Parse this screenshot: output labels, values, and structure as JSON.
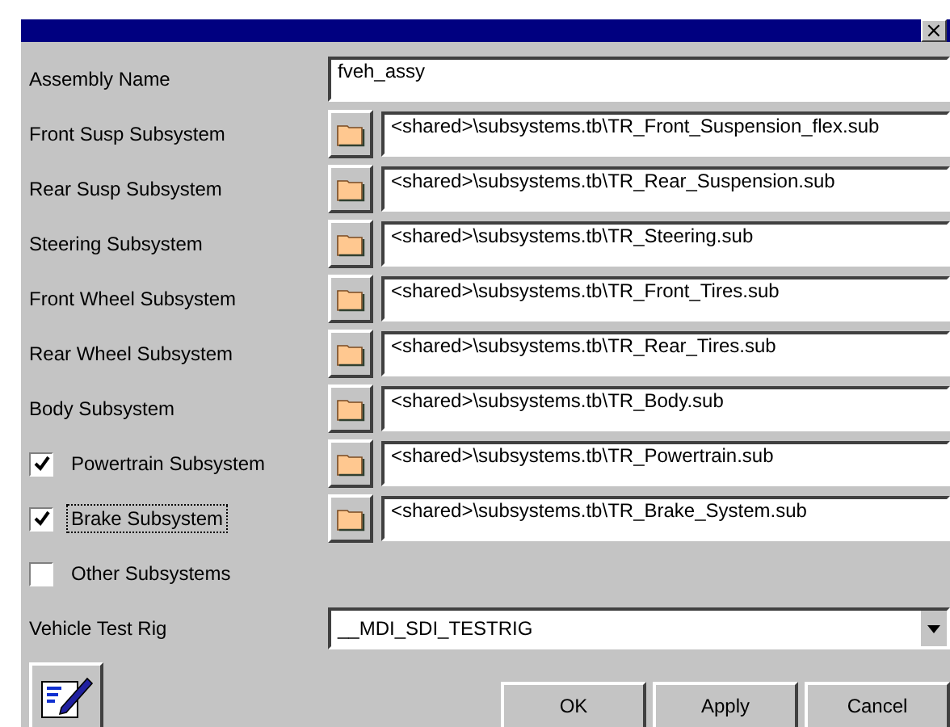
{
  "window": {
    "close": "×"
  },
  "assembly": {
    "label": "Assembly Name",
    "value": "fveh_assy"
  },
  "subsystems": [
    {
      "kind": "plain",
      "label": "Front Susp Subsystem",
      "path": "<shared>\\subsystems.tb\\TR_Front_Suspension_flex.sub"
    },
    {
      "kind": "plain",
      "label": "Rear Susp Subsystem",
      "path": "<shared>\\subsystems.tb\\TR_Rear_Suspension.sub"
    },
    {
      "kind": "plain",
      "label": "Steering Subsystem",
      "path": "<shared>\\subsystems.tb\\TR_Steering.sub"
    },
    {
      "kind": "plain",
      "label": "Front Wheel Subsystem",
      "path": "<shared>\\subsystems.tb\\TR_Front_Tires.sub"
    },
    {
      "kind": "plain",
      "label": "Rear Wheel Subsystem",
      "path": "<shared>\\subsystems.tb\\TR_Rear_Tires.sub"
    },
    {
      "kind": "plain",
      "label": "Body Subsystem",
      "path": "<shared>\\subsystems.tb\\TR_Body.sub"
    },
    {
      "kind": "checkbox",
      "label": "Powertrain Subsystem",
      "checked": true,
      "focused": false,
      "path": "<shared>\\subsystems.tb\\TR_Powertrain.sub"
    },
    {
      "kind": "checkbox",
      "label": "Brake Subsystem",
      "checked": true,
      "focused": true,
      "path": "<shared>\\subsystems.tb\\TR_Brake_System.sub"
    },
    {
      "kind": "checkbox",
      "label": "Other Subsystems",
      "checked": false,
      "focused": false
    }
  ],
  "test_rig": {
    "label": "Vehicle Test Rig",
    "value": "__MDI_SDI_TESTRIG"
  },
  "buttons": [
    "OK",
    "Apply",
    "Cancel"
  ]
}
